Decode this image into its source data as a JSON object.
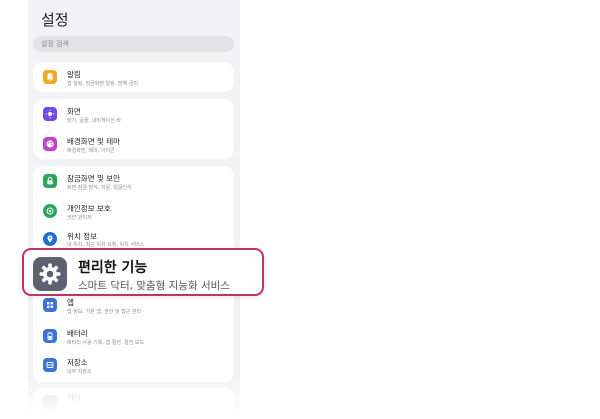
{
  "header": {
    "title": "설정"
  },
  "search": {
    "placeholder": "설정 검색"
  },
  "items": [
    {
      "label": "알림",
      "sub": "앱 알림, 잠금화면 알림, 방해 금지",
      "icon": "bell-icon",
      "color": "#f5a623"
    },
    {
      "label": "화면",
      "sub": "밝기, 글꼴, 내비게이션 바",
      "icon": "sun-icon",
      "color": "#6f49e6"
    },
    {
      "label": "배경화면 및 테마",
      "sub": "배경화면, 테마, 아이콘",
      "icon": "palette-icon",
      "color": "#c243c9"
    },
    {
      "label": "잠금화면 및 보안",
      "sub": "화면 잠금 방식, 지문, 얼굴인식",
      "icon": "lock-icon",
      "color": "#2aa55a"
    },
    {
      "label": "개인정보 보호",
      "sub": "권한 관리자",
      "icon": "privacy-icon",
      "color": "#2aa55a"
    },
    {
      "label": "위치 정보",
      "sub": "내 위치, 최근 위치 요청, 위치 서비스",
      "icon": "location-pin-icon",
      "color": "#1f6fd1"
    },
    {
      "label": "앱",
      "sub": "앱 정보, 기본 앱, 권한 및 접근 관리",
      "icon": "apps-grid-icon",
      "color": "#3a74d8"
    },
    {
      "label": "배터리",
      "sub": "배터리 사용 기록, 앱 절전, 절전 모드",
      "icon": "battery-icon",
      "color": "#3a74d8"
    },
    {
      "label": "저장소",
      "sub": "내부 저장소",
      "icon": "storage-icon",
      "color": "#3a74d8"
    },
    {
      "label": "기타",
      "sub": "",
      "icon": "more-icon",
      "color": "#9aa0a8"
    }
  ],
  "callout": {
    "label": "편리한 기능",
    "sub": "스마트 닥터, 맞춤형 지능화 서비스",
    "icon": "gear-icon",
    "accent": "#c4306a"
  }
}
